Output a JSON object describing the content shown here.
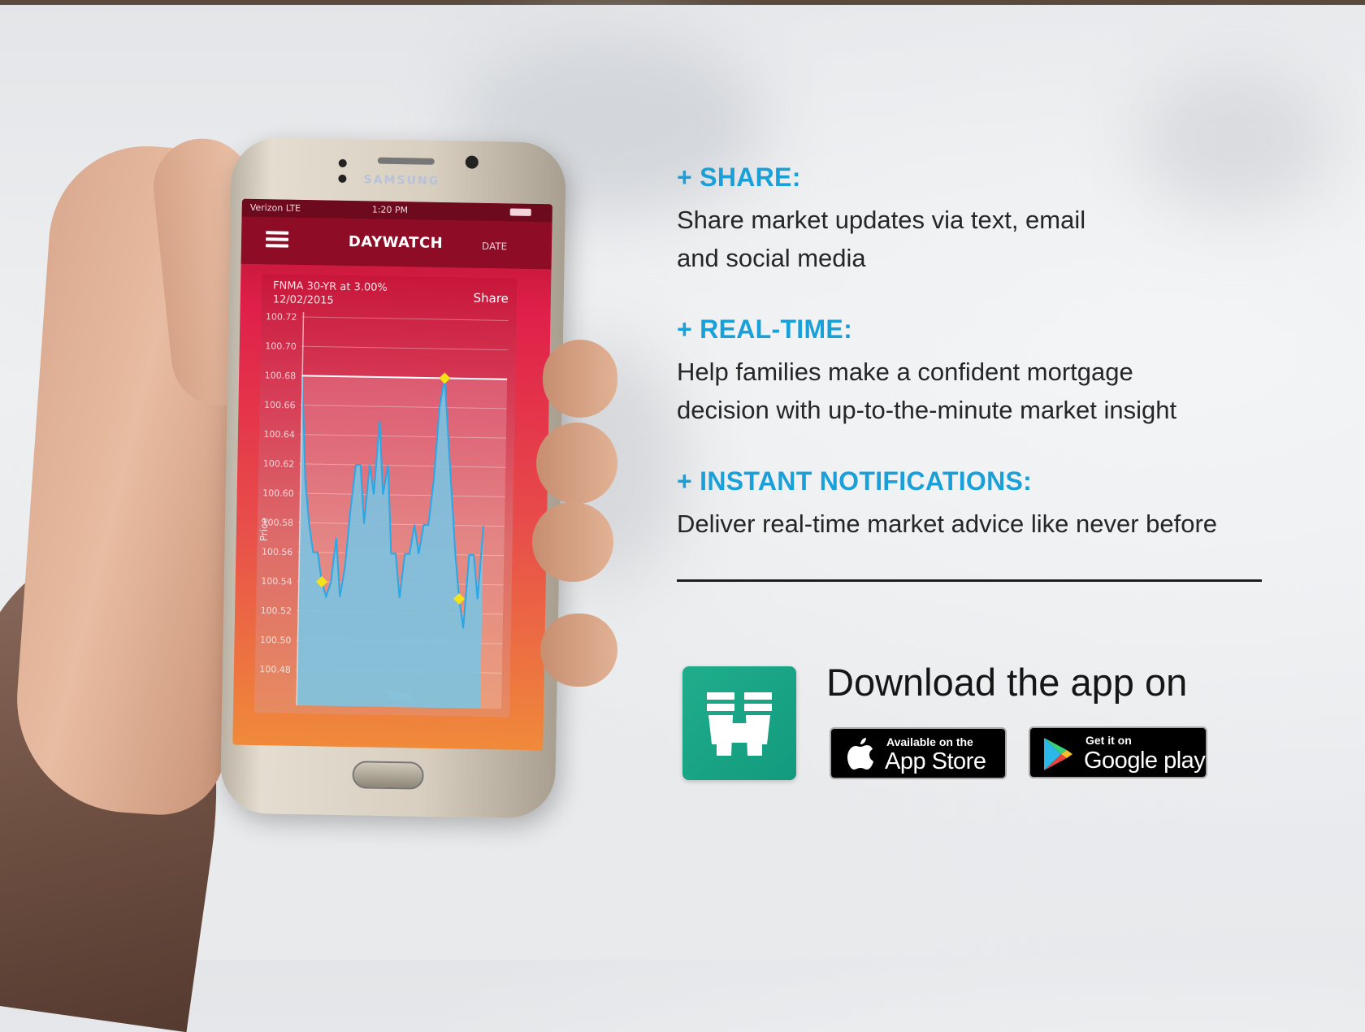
{
  "phone": {
    "brand": "SAMSUNG",
    "status": {
      "carrier": "Verizon  LTE",
      "time": "1:20 PM"
    },
    "app_title": "DAYWATCH",
    "date_button": "DATE",
    "card": {
      "subtitle_line1": "FNMA 30-YR at 3.00%",
      "subtitle_line2": "12/02/2015",
      "share_label": "Share"
    },
    "menu_icon": "hamburger-menu-icon"
  },
  "features": [
    {
      "title": "+ SHARE:",
      "line1": "Share market updates via text, email",
      "line2": "and social media"
    },
    {
      "title": "+ REAL-TIME:",
      "line1": "Help families make a confident mortgage",
      "line2": "decision with up-to-the-minute market insight"
    },
    {
      "title": "+ INSTANT NOTIFICATIONS:",
      "line1": "Deliver real-time market advice like never before",
      "line2": ""
    }
  ],
  "download": {
    "title": "Download the app on",
    "app_icon": "binoculars-icon",
    "app_store": {
      "small": "Available on the",
      "big": "App Store",
      "icon": "apple-icon"
    },
    "google_play": {
      "small": "Get it on",
      "big": "Google play",
      "icon": "play-triangle-icon"
    }
  },
  "colors": {
    "feature_title": "#1aa0d8",
    "app_icon_green": "#1fae8c",
    "chart_fill": "#5fb6dc",
    "chart_line": "#2aa8e6",
    "marker": "#f2e21a"
  },
  "chart_data": {
    "type": "area",
    "ylabel": "Price",
    "xlabel": "Time",
    "yticks": [
      "100.72",
      "100.70",
      "100.68",
      "100.66",
      "100.64",
      "100.62",
      "100.60",
      "100.58",
      "100.56",
      "100.54",
      "100.52",
      "100.50",
      "100.48"
    ],
    "ylim": [
      100.48,
      100.72
    ],
    "max_line": 100.68,
    "series": [
      {
        "values": [
          100.68,
          100.61,
          100.58,
          100.56,
          100.56,
          100.54,
          100.53,
          100.54,
          100.57,
          100.53,
          100.55,
          100.59,
          100.62,
          100.62,
          100.58,
          100.62,
          100.6,
          100.65,
          100.6,
          100.62,
          100.56,
          100.56,
          100.53,
          100.56,
          100.56,
          100.58,
          100.56,
          100.58,
          100.58,
          100.61,
          100.66,
          100.68,
          100.64,
          100.6,
          100.56,
          100.53,
          100.51,
          100.56,
          100.56,
          100.53,
          100.58
        ]
      }
    ],
    "markers": [
      100.54,
      100.68,
      100.53
    ]
  }
}
